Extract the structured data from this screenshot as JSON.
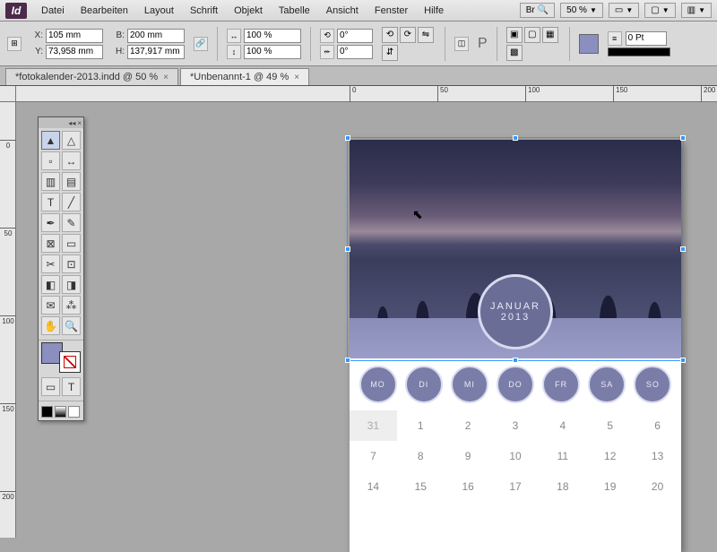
{
  "app": {
    "logo": "Id"
  },
  "menu": {
    "items": [
      "Datei",
      "Bearbeiten",
      "Layout",
      "Schrift",
      "Objekt",
      "Tabelle",
      "Ansicht",
      "Fenster",
      "Hilfe"
    ],
    "br_label": "Br",
    "zoom": "50 %"
  },
  "controls": {
    "x_label": "X:",
    "x": "105 mm",
    "y_label": "Y:",
    "y": "73,958 mm",
    "w_label": "B:",
    "w": "200 mm",
    "h_label": "H:",
    "h": "137,917 mm",
    "scale_x": "100 %",
    "scale_y": "100 %",
    "rotate": "0°",
    "shear": "0°",
    "stroke_pt": "0 Pt"
  },
  "tabs": [
    {
      "label": "*fotokalender-2013.indd @ 50 %",
      "active": false
    },
    {
      "label": "*Unbenannt-1 @ 49 %",
      "active": true
    }
  ],
  "ruler_h": [
    "0",
    "50",
    "100",
    "150",
    "200"
  ],
  "ruler_v": [
    "0",
    "50",
    "100",
    "150",
    "200"
  ],
  "calendar": {
    "month": "JANUAR",
    "year": "2013",
    "days": [
      "MO",
      "DI",
      "MI",
      "DO",
      "FR",
      "SA",
      "SO"
    ],
    "cells": [
      {
        "n": "31",
        "prev": true
      },
      {
        "n": "1"
      },
      {
        "n": "2"
      },
      {
        "n": "3"
      },
      {
        "n": "4"
      },
      {
        "n": "5"
      },
      {
        "n": "6"
      },
      {
        "n": "7"
      },
      {
        "n": "8"
      },
      {
        "n": "9"
      },
      {
        "n": "10"
      },
      {
        "n": "11"
      },
      {
        "n": "12"
      },
      {
        "n": "13"
      },
      {
        "n": "14"
      },
      {
        "n": "15"
      },
      {
        "n": "16"
      },
      {
        "n": "17"
      },
      {
        "n": "18"
      },
      {
        "n": "19"
      },
      {
        "n": "20"
      }
    ]
  },
  "tools": [
    "selection",
    "direct-selection",
    "page",
    "gap",
    "content-collector",
    "content-placer",
    "type",
    "line",
    "pen",
    "pencil",
    "rectangle-frame",
    "rectangle",
    "scissors",
    "free-transform",
    "gradient-swatch",
    "gradient-feather",
    "note",
    "eyedropper",
    "hand",
    "zoom"
  ]
}
